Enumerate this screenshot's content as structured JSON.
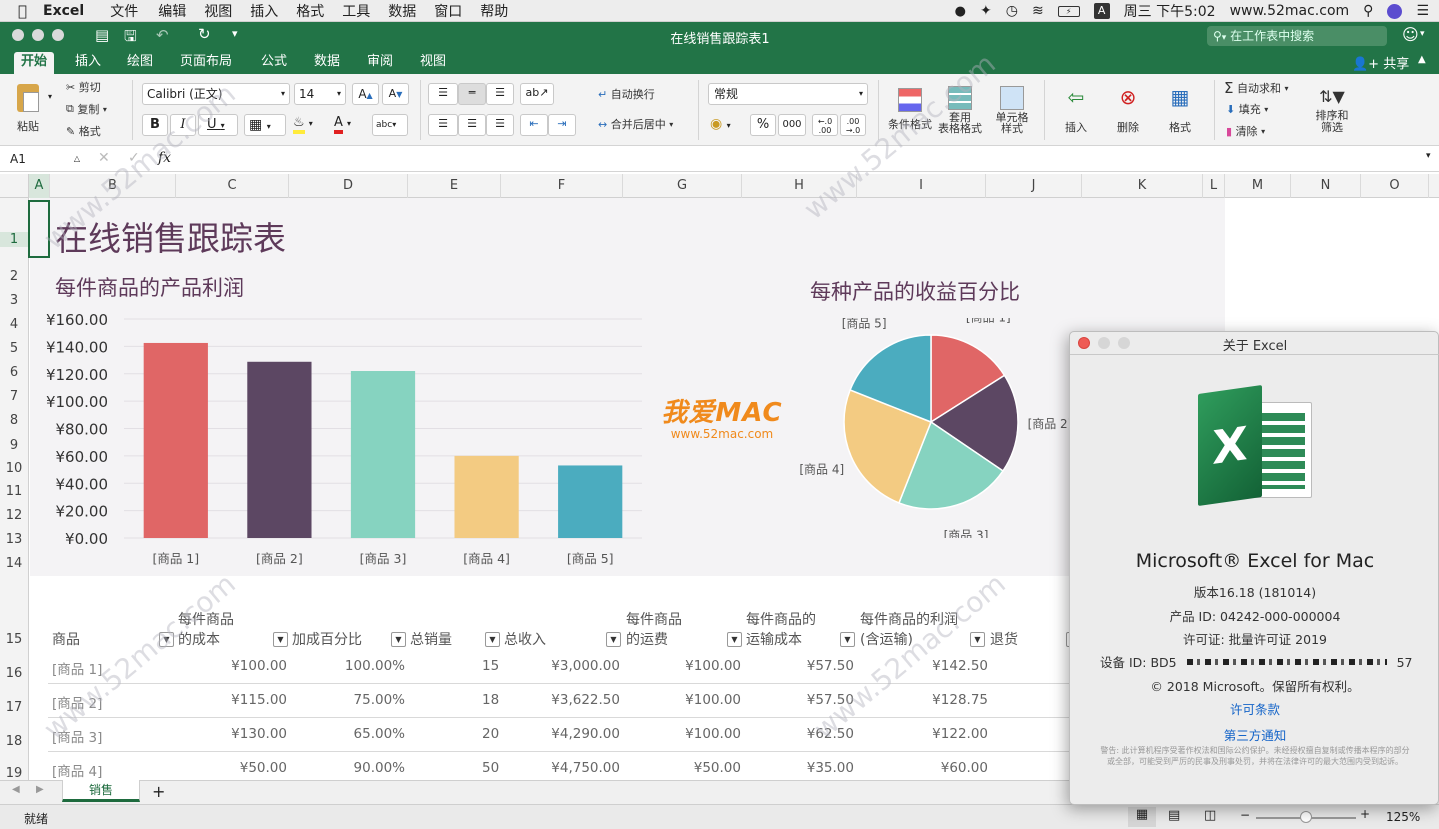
{
  "menubar": {
    "app": "Excel",
    "items": [
      "文件",
      "编辑",
      "视图",
      "插入",
      "格式",
      "工具",
      "数据",
      "窗口",
      "帮助"
    ],
    "clock": "周三 下午5:02",
    "site": "www.52mac.com"
  },
  "titlebar": {
    "title": "在线销售跟踪表1",
    "search_placeholder": "在工作表中搜索"
  },
  "tabs": [
    "开始",
    "插入",
    "绘图",
    "页面布局",
    "公式",
    "数据",
    "审阅",
    "视图"
  ],
  "share_label": "共享",
  "ribbon": {
    "paste": "粘贴",
    "cut": "剪切",
    "copy": "复制",
    "format_painter": "格式",
    "font_name": "Calibri (正文)",
    "font_size": "14",
    "wrap": "自动换行",
    "merge": "合并后居中",
    "number_format": "常规",
    "percent": "%",
    "thousands": "000",
    "cond_format": "条件格式",
    "table_format": "套用\n表格格式",
    "cell_style": "单元格\n样式",
    "insert": "插入",
    "delete": "删除",
    "format": "格式",
    "autosum": "自动求和",
    "fill": "填充",
    "clear": "清除",
    "sort": "排序和\n筛选"
  },
  "formula_bar": {
    "cell_ref": "A1",
    "fx": "fx",
    "value": ""
  },
  "columns": [
    "A",
    "B",
    "C",
    "D",
    "E",
    "F",
    "G",
    "H",
    "I",
    "J",
    "K",
    "L",
    "M",
    "N",
    "O"
  ],
  "rows": [
    "1",
    "2",
    "3",
    "4",
    "5",
    "6",
    "7",
    "8",
    "9",
    "10",
    "11",
    "12",
    "13",
    "14",
    "15",
    "16",
    "17",
    "18",
    "19"
  ],
  "sheet_title": "在线销售跟踪表",
  "bar_chart": {
    "title": "每件商品的产品利润"
  },
  "pie_chart": {
    "title": "每种产品的收益百分比"
  },
  "chart_data": [
    {
      "type": "bar",
      "title": "每件商品的产品利润",
      "categories": [
        "[商品 1]",
        "[商品 2]",
        "[商品 3]",
        "[商品 4]",
        "[商品 5]"
      ],
      "values": [
        142.5,
        128.75,
        122,
        60,
        53
      ],
      "y_ticks": [
        "¥160.00",
        "¥140.00",
        "¥120.00",
        "¥100.00",
        "¥80.00",
        "¥60.00",
        "¥40.00",
        "¥20.00",
        "¥0.00"
      ],
      "ylim": [
        0,
        160
      ],
      "colors": [
        "#e06666",
        "#5c4763",
        "#86d3c0",
        "#f3cb82",
        "#4bacbf"
      ],
      "grid": true
    },
    {
      "type": "pie",
      "title": "每种产品的收益百分比",
      "categories": [
        "[商品 1]",
        "[商品 2]",
        "[商品 3]",
        "[商品 4]",
        "[商品 5]"
      ],
      "values": [
        16.0,
        18.5,
        21.5,
        25.0,
        19.0
      ],
      "colors": [
        "#e06666",
        "#5c4763",
        "#86d3c0",
        "#f3cb82",
        "#4bacbf"
      ]
    }
  ],
  "watermark": {
    "brand": "我爱MAC",
    "url": "www.52mac.com"
  },
  "table": {
    "headers": [
      {
        "line1": "",
        "line2": "商品"
      },
      {
        "line1": "每件商品",
        "line2": "的成本"
      },
      {
        "line1": "",
        "line2": "加成百分比"
      },
      {
        "line1": "",
        "line2": "总销量"
      },
      {
        "line1": "",
        "line2": "总收入"
      },
      {
        "line1": "每件商品",
        "line2": "的运费"
      },
      {
        "line1": "每件商品的",
        "line2": "运输成本"
      },
      {
        "line1": "每件商品的利润",
        "line2": "(含运输)"
      },
      {
        "line1": "",
        "line2": "退货"
      }
    ],
    "rows": [
      [
        "[商品 1]",
        "¥100.00",
        "100.00%",
        "15",
        "¥3,000.00",
        "¥100.00",
        "¥57.50",
        "¥142.50"
      ],
      [
        "[商品 2]",
        "¥115.00",
        "75.00%",
        "18",
        "¥3,622.50",
        "¥100.00",
        "¥57.50",
        "¥128.75"
      ],
      [
        "[商品 3]",
        "¥130.00",
        "65.00%",
        "20",
        "¥4,290.00",
        "¥100.00",
        "¥62.50",
        "¥122.00"
      ],
      [
        "[商品 4]",
        "¥50.00",
        "90.00%",
        "50",
        "¥4,750.00",
        "¥50.00",
        "¥35.00",
        "¥60.00"
      ]
    ]
  },
  "sheet_tab": "销售",
  "status": {
    "ready": "就绪",
    "zoom": "125%"
  },
  "about": {
    "window_title": "关于 Excel",
    "product": "Microsoft® Excel for Mac",
    "version": "版本16.18 (181014)",
    "product_id": "产品 ID: 04242-000-000004",
    "license": "许可证: 批量许可证 2019",
    "device_id": "设备 ID: BD5",
    "device_id_tail": "57",
    "copyright": "© 2018 Microsoft。保留所有权利。",
    "terms_link": "许可条款",
    "third_party_link": "第三方通知",
    "warning": "警告: 此计算机程序受著作权法和国际公约保护。未经授权擅自复制或传播本程序的部分或全部，可能受到严厉的民事及刑事处罚，并将在法律许可的最大范围内受到起诉。"
  }
}
